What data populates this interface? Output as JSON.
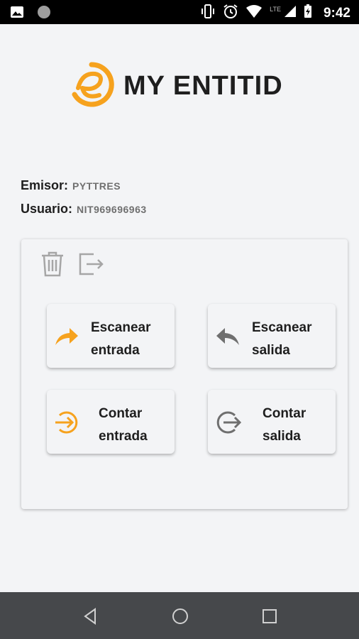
{
  "status_bar": {
    "time": "9:42",
    "network": "LTE",
    "icons": [
      "image-icon",
      "circle-notification-icon",
      "vibrate-icon",
      "alarm-icon",
      "wifi-icon",
      "signal-icon",
      "battery-icon"
    ]
  },
  "app": {
    "logo_text": "MY ENTITID",
    "brand_color": "#f6a21e"
  },
  "info": {
    "emisor_label": "Emisor:",
    "emisor_value": "PYTTRES",
    "usuario_label": "Usuario:",
    "usuario_value": "NIT969696963"
  },
  "card": {
    "toolbar_icons": [
      "trash-icon",
      "logout-icon"
    ],
    "buttons": [
      {
        "line1": "Escanear",
        "line2": "entrada",
        "icon": "forward-arrow-icon",
        "icon_color": "#f6a21e"
      },
      {
        "line1": "Escanear",
        "line2": "salida",
        "icon": "reply-arrow-icon",
        "icon_color": "#6f6f6f"
      },
      {
        "line1": "Contar",
        "line2": "entrada",
        "icon": "login-circle-icon",
        "icon_color": "#f6a21e"
      },
      {
        "line1": "Contar",
        "line2": "salida",
        "icon": "logout-circle-icon",
        "icon_color": "#6f6f6f"
      }
    ]
  },
  "nav_bar": {
    "buttons": [
      "back-icon",
      "home-icon",
      "recents-icon"
    ]
  }
}
